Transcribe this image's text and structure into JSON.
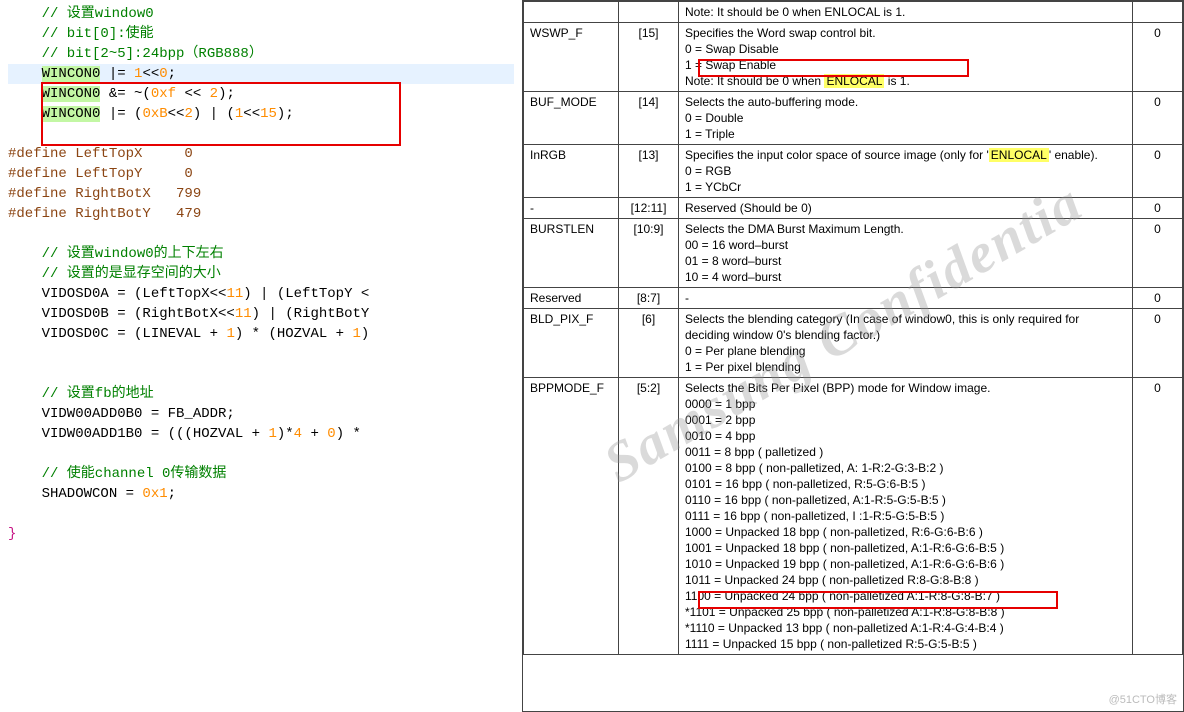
{
  "code": {
    "c1": "    // 设置window0",
    "c2": "    // bit[0]:使能",
    "c3": "    // bit[2~5]:24bpp（RGB888）",
    "hl1": "WINCON0",
    "l4b": " |= ",
    "l4n1": "1",
    "l4c": "<<",
    "l4n2": "0",
    "l4d": ";",
    "l5b": " &= ~(",
    "l5n1": "0xf",
    "l5c": " << ",
    "l5n2": "2",
    "l5d": ");",
    "l6b": " |= (",
    "l6n1": "0xB",
    "l6c": "<<",
    "l6n2": "2",
    "l6d": ") | (",
    "l6n3": "1",
    "l6e": "<<",
    "l6n4": "15",
    "l6f": ");",
    "d1": "#define LeftTopX     0",
    "d2": "#define LeftTopY     0",
    "d3": "#define RightBotX   799",
    "d4": "#define RightBotY   479",
    "c7": "    // 设置window0的上下左右",
    "c8": "    // 设置的是显存空间的大小",
    "l9": "    VIDOSD0A = (LeftTopX<<",
    "l9n": "11",
    "l9b": ") | (LeftTopY <",
    "l10": "    VIDOSD0B = (RightBotX<<",
    "l10n": "11",
    "l10b": ") | (RightBotY",
    "l11": "    VIDOSD0C = (LINEVAL + ",
    "l11n1": "1",
    "l11b": ") * (HOZVAL + ",
    "l11n2": "1",
    "l11c": ")",
    "c12": "    // 设置fb的地址",
    "l13": "    VIDW00ADD0B0 = FB_ADDR;",
    "l14": "    VIDW00ADD1B0 = (((HOZVAL + ",
    "l14n1": "1",
    "l14b": ")*",
    "l14n2": "4",
    "l14c": " + ",
    "l14n3": "0",
    "l14d": ") *",
    "c15": "    // 使能channel 0传输数据",
    "l16": "    SHADOWCON = ",
    "l16n": "0x1",
    "l16b": ";",
    "brace": "}"
  },
  "table": {
    "r0_note": "Note: It should be 0 when ENLOCAL is 1.",
    "r1": {
      "name": "WSWP_F",
      "bit": "[15]",
      "desc": "Specifies the Word swap control bit.\n0 = Swap Disable\n1 = Swap Enable\nNote: It should be 0 when ",
      "hl": "ENLOCAL",
      "desc2": " is 1.",
      "rst": "0"
    },
    "r2": {
      "name": "BUF_MODE",
      "bit": "[14]",
      "desc": "Selects the auto-buffering mode.\n0 = Double\n1 = Triple",
      "rst": "0"
    },
    "r3": {
      "name": "InRGB",
      "bit": "[13]",
      "desc": "Specifies the input color space of source image (only for '",
      "hl": "ENLOCAL",
      "desc2": "' enable).\n0 = RGB\n1 = YCbCr",
      "rst": "0"
    },
    "r4": {
      "name": "-",
      "bit": "[12:11]",
      "desc": "Reserved (Should be 0)",
      "rst": "0"
    },
    "r5": {
      "name": "BURSTLEN",
      "bit": "[10:9]",
      "desc": "Selects the DMA Burst Maximum Length.\n00 = 16 word–burst\n01 = 8 word–burst\n10 = 4 word–burst",
      "rst": "0"
    },
    "r6": {
      "name": "Reserved",
      "bit": "[8:7]",
      "desc": "-",
      "rst": "0"
    },
    "r7": {
      "name": "BLD_PIX_F",
      "bit": "[6]",
      "desc": "Selects the blending category (In case of window0, this is only required for deciding window 0's blending factor.)\n0 = Per plane blending\n1 = Per pixel blending",
      "rst": "0"
    },
    "r8": {
      "name": "BPPMODE_F",
      "bit": "[5:2]",
      "desc_lines": [
        "Selects the Bits Per Pixel (BPP) mode for Window image.",
        "0000 = 1 bpp",
        "0001 = 2 bpp",
        "0010 = 4 bpp",
        "0011 = 8 bpp ( palletized )",
        "0100 = 8 bpp ( non-palletized, A: 1-R:2-G:3-B:2 )",
        "0101 = 16 bpp ( non-palletized, R:5-G:6-B:5 )",
        "0110 = 16 bpp ( non-palletized, A:1-R:5-G:5-B:5 )",
        "0111 = 16 bpp ( non-palletized, I :1-R:5-G:5-B:5 )",
        "1000 = Unpacked 18 bpp ( non-palletized, R:6-G:6-B:6 )",
        "1001 = Unpacked 18 bpp ( non-palletized, A:1-R:6-G:6-B:5 )",
        "1010 = Unpacked 19 bpp ( non-palletized, A:1-R:6-G:6-B:6 )",
        "1011 = Unpacked 24 bpp ( non-palletized R:8-G:8-B:8 )",
        "1100 = Unpacked 24 bpp ( non-palletized A:1-R:8-G:8-B:7 )",
        "*1101 = Unpacked 25 bpp ( non-palletized A:1-R:8-G:8-B:8 )",
        "*1110 = Unpacked 13 bpp ( non-palletized A:1-R:4-G:4-B:4 )",
        "1111 = Unpacked 15 bpp ( non-palletized R:5-G:5-B:5 )"
      ],
      "rst": "0"
    }
  },
  "watermark": "Samsung Confidentia",
  "blog": "@51CTO博客"
}
